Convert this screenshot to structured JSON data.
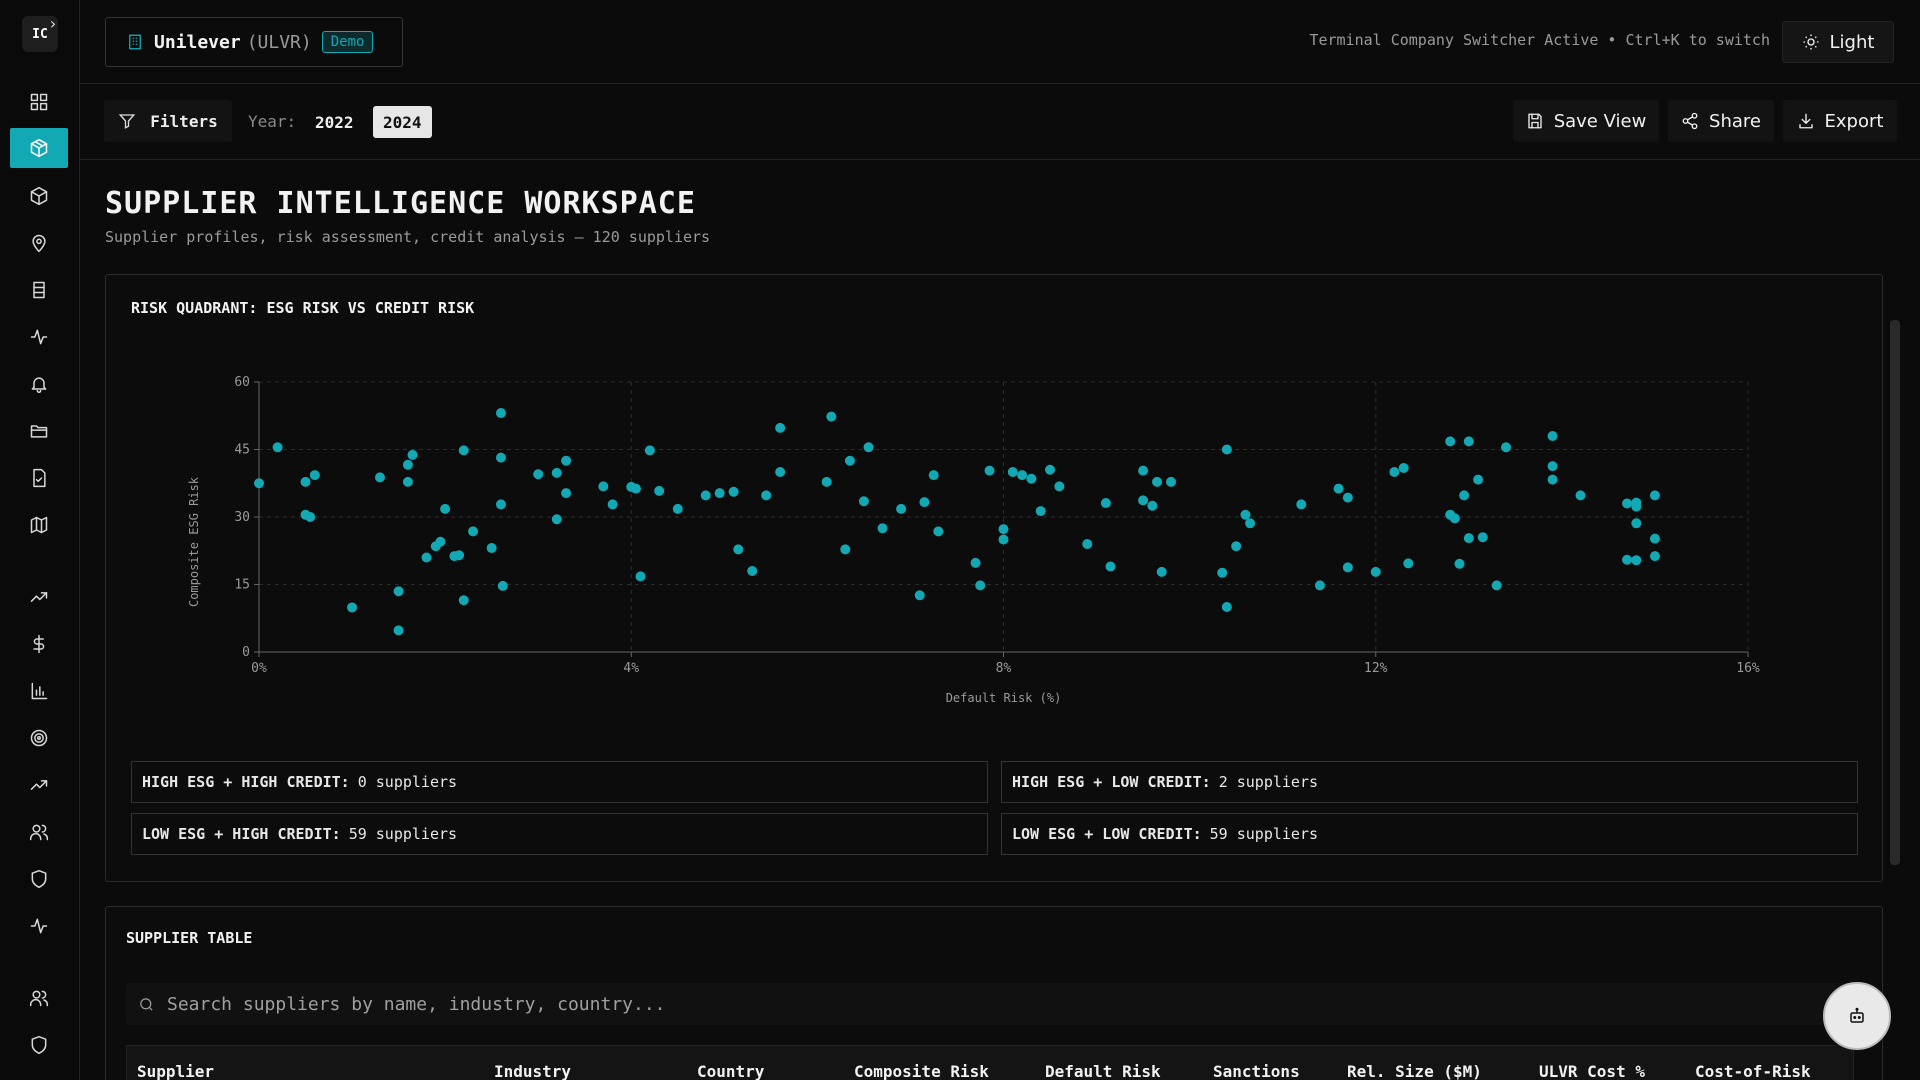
{
  "header": {
    "company_name": "Unilever",
    "company_ticker": "(ULVR)",
    "demo_badge": "Demo",
    "switcher_text": "Terminal Company Switcher Active • Ctrl+K to switch",
    "theme_toggle": "Light"
  },
  "toolbar": {
    "filters_label": "Filters",
    "year_label": "Year:",
    "years": [
      "2022",
      "2024"
    ],
    "selected_year": "2024",
    "save_view": "Save View",
    "share": "Share",
    "export": "Export"
  },
  "page": {
    "title": "SUPPLIER INTELLIGENCE WORKSPACE",
    "subtitle": "Supplier profiles, risk assessment, credit analysis — 120 suppliers"
  },
  "risk_panel": {
    "title": "RISK QUADRANT: ESG RISK VS CREDIT RISK",
    "quadrants": [
      {
        "label": "HIGH ESG + HIGH CREDIT:",
        "value": "0 suppliers"
      },
      {
        "label": "HIGH ESG + LOW CREDIT:",
        "value": "2 suppliers"
      },
      {
        "label": "LOW ESG + HIGH CREDIT:",
        "value": "59 suppliers"
      },
      {
        "label": "LOW ESG + LOW CREDIT:",
        "value": "59 suppliers"
      }
    ]
  },
  "table_panel": {
    "title": "SUPPLIER TABLE",
    "search_placeholder": "Search suppliers by name, industry, country...",
    "columns": [
      "Supplier",
      "Industry",
      "Country",
      "Composite Risk",
      "Default Risk",
      "Sanctions",
      "Rel. Size ($M)",
      "ULVR Cost %",
      "Cost-of-Risk"
    ]
  },
  "colors": {
    "accent": "#12a9b4",
    "background": "#0b0b0b"
  },
  "icons": {
    "sidebar": [
      "dashboard-icon",
      "cube-active-icon",
      "package-icon",
      "location-pin-icon",
      "building-icon",
      "activity-icon",
      "bell-icon",
      "folder-icon",
      "document-check-icon",
      "map-icon",
      "trending-up-icon",
      "dollar-icon",
      "bar-chart-icon",
      "target-icon",
      "trending-up-icon",
      "users-icon",
      "shield-icon",
      "activity-icon",
      "users-icon",
      "shield-icon"
    ],
    "chatbot": "bot-icon"
  },
  "chart_data": {
    "type": "scatter",
    "title": "RISK QUADRANT: ESG RISK VS CREDIT RISK",
    "xlabel": "Default Risk (%)",
    "ylabel": "Composite ESG Risk",
    "xlim": [
      0,
      16
    ],
    "ylim": [
      0,
      60
    ],
    "x_ticks": [
      "0%",
      "4%",
      "8%",
      "12%",
      "16%"
    ],
    "y_ticks": [
      "0",
      "15",
      "30",
      "45",
      "60"
    ],
    "grid": true,
    "color": "#12a9b4",
    "points": [
      [
        0.0,
        37.5
      ],
      [
        0.2,
        45.5
      ],
      [
        0.5,
        37.8
      ],
      [
        0.5,
        30.5
      ],
      [
        0.6,
        39.3
      ],
      [
        0.55,
        30.0
      ],
      [
        1.0,
        9.9
      ],
      [
        1.3,
        38.8
      ],
      [
        1.5,
        13.5
      ],
      [
        1.5,
        4.8
      ],
      [
        1.6,
        37.8
      ],
      [
        1.6,
        41.6
      ],
      [
        1.65,
        43.8
      ],
      [
        1.8,
        21.0
      ],
      [
        1.9,
        23.5
      ],
      [
        1.95,
        24.5
      ],
      [
        2.0,
        31.8
      ],
      [
        2.1,
        21.3
      ],
      [
        2.15,
        21.5
      ],
      [
        2.2,
        44.8
      ],
      [
        2.2,
        11.5
      ],
      [
        2.3,
        26.8
      ],
      [
        2.5,
        23.1
      ],
      [
        2.6,
        32.8
      ],
      [
        2.6,
        43.2
      ],
      [
        2.6,
        53.1
      ],
      [
        2.62,
        14.7
      ],
      [
        3.0,
        39.5
      ],
      [
        3.2,
        39.8
      ],
      [
        3.2,
        29.5
      ],
      [
        3.3,
        42.5
      ],
      [
        3.3,
        35.3
      ],
      [
        3.7,
        36.8
      ],
      [
        3.8,
        32.8
      ],
      [
        4.0,
        36.7
      ],
      [
        4.05,
        36.3
      ],
      [
        4.1,
        16.8
      ],
      [
        4.2,
        44.8
      ],
      [
        4.3,
        35.8
      ],
      [
        4.5,
        31.8
      ],
      [
        4.8,
        34.8
      ],
      [
        4.95,
        35.3
      ],
      [
        5.1,
        35.6
      ],
      [
        5.15,
        22.8
      ],
      [
        5.3,
        18.0
      ],
      [
        5.45,
        34.8
      ],
      [
        5.6,
        49.8
      ],
      [
        5.6,
        40.0
      ],
      [
        6.1,
        37.8
      ],
      [
        6.15,
        52.3
      ],
      [
        6.35,
        42.5
      ],
      [
        6.3,
        22.8
      ],
      [
        6.5,
        33.5
      ],
      [
        6.55,
        45.5
      ],
      [
        6.7,
        27.5
      ],
      [
        6.9,
        31.8
      ],
      [
        7.1,
        12.6
      ],
      [
        7.15,
        33.3
      ],
      [
        7.25,
        39.3
      ],
      [
        7.3,
        26.8
      ],
      [
        7.7,
        19.8
      ],
      [
        7.75,
        14.8
      ],
      [
        7.85,
        40.3
      ],
      [
        8.0,
        25.0
      ],
      [
        8.0,
        27.3
      ],
      [
        8.1,
        40.0
      ],
      [
        8.2,
        39.3
      ],
      [
        8.3,
        38.5
      ],
      [
        8.4,
        31.3
      ],
      [
        8.5,
        40.5
      ],
      [
        8.6,
        36.8
      ],
      [
        8.9,
        24.0
      ],
      [
        9.1,
        33.1
      ],
      [
        9.15,
        19.0
      ],
      [
        9.5,
        40.3
      ],
      [
        9.5,
        33.7
      ],
      [
        9.6,
        32.5
      ],
      [
        9.65,
        37.8
      ],
      [
        9.7,
        17.8
      ],
      [
        9.8,
        37.8
      ],
      [
        10.35,
        17.6
      ],
      [
        10.4,
        45.0
      ],
      [
        10.4,
        10.0
      ],
      [
        10.5,
        23.5
      ],
      [
        10.6,
        30.5
      ],
      [
        10.65,
        28.6
      ],
      [
        11.2,
        32.8
      ],
      [
        11.4,
        14.8
      ],
      [
        11.6,
        36.3
      ],
      [
        11.7,
        34.3
      ],
      [
        11.7,
        18.8
      ],
      [
        12.0,
        17.8
      ],
      [
        12.2,
        40.0
      ],
      [
        12.3,
        40.9
      ],
      [
        12.35,
        19.7
      ],
      [
        12.8,
        30.5
      ],
      [
        12.85,
        29.7
      ],
      [
        12.8,
        46.8
      ],
      [
        12.9,
        19.6
      ],
      [
        12.95,
        34.8
      ],
      [
        13.0,
        46.8
      ],
      [
        13.0,
        25.3
      ],
      [
        13.1,
        38.3
      ],
      [
        13.15,
        25.5
      ],
      [
        13.3,
        14.8
      ],
      [
        13.4,
        45.5
      ],
      [
        13.9,
        48.0
      ],
      [
        13.9,
        41.3
      ],
      [
        13.9,
        38.3
      ],
      [
        14.2,
        34.8
      ],
      [
        14.7,
        33.0
      ],
      [
        14.8,
        33.2
      ],
      [
        14.8,
        32.3
      ],
      [
        14.8,
        28.6
      ],
      [
        14.7,
        20.5
      ],
      [
        14.8,
        20.4
      ],
      [
        15.0,
        25.2
      ],
      [
        15.0,
        34.8
      ],
      [
        15.0,
        21.3
      ]
    ]
  }
}
